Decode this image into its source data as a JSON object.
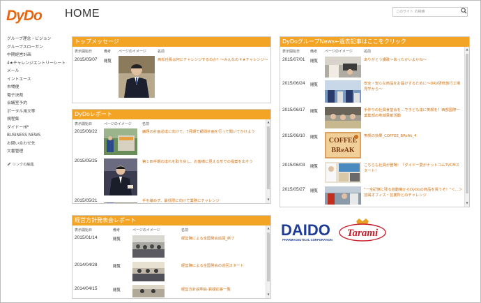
{
  "header": {
    "logo_text": "DyDo",
    "title": "HOME",
    "search_placeholder": "このサイト の検索",
    "colors": {
      "brand": "#e8650d",
      "panel_header": "#f4a425",
      "link": "#d07010"
    }
  },
  "sidebar": {
    "items": [
      {
        "label": "グループ理念・ビジョン"
      },
      {
        "label": "グループスローガン"
      },
      {
        "label": "中期経営計画"
      },
      {
        "label": "4★チャレンジエントリーシート"
      },
      {
        "label": "メール"
      },
      {
        "label": "イントエース"
      },
      {
        "label": "市場便"
      },
      {
        "label": "電子決裁"
      },
      {
        "label": "会議室予約"
      },
      {
        "label": "ポータル用文等"
      },
      {
        "label": "規程集"
      },
      {
        "label": "ダイドーHP"
      },
      {
        "label": "BUSINESS NEWS"
      },
      {
        "label": "お問い合わせ先"
      },
      {
        "label": "文書管理"
      }
    ],
    "edit_link": "リンクの編集"
  },
  "top_message": {
    "title": "トップメッセージ",
    "columns": [
      "表示開始日",
      "備考",
      "ページのイメージ",
      "名前"
    ],
    "rows": [
      {
        "date": "2015/05/07",
        "cat": "閲覧",
        "title": "高松社長は何にチャレンジするのか？～みんなの４★チャレンジ～"
      }
    ]
  },
  "dydo_report": {
    "title": "DyDoレポート",
    "columns": [
      "表示開始日",
      "ページのイメージ",
      "名前"
    ],
    "rows": [
      {
        "date": "2015/06/22",
        "title": "議題の計画必達に向けて、7月期で顧問計画を行って聞いてかけよう"
      },
      {
        "date": "2015/05/25",
        "title": "第１四半期の達れを取り戻し、お客様に見える形での提案を出そう"
      },
      {
        "date": "2015/05/21",
        "title": "手を緩めず、最低限に向けて業務にチャレンジ"
      }
    ]
  },
  "policy_report": {
    "title": "経営方針発表会レポート",
    "columns": [
      "表示開始日",
      "備考",
      "ページのイメージ",
      "名前"
    ],
    "rows": [
      {
        "date": "2015/01/14",
        "cat": "閲覧",
        "title": "経営陣による全国発会巡回_終了"
      },
      {
        "date": "2014/04/28",
        "cat": "閲覧",
        "title": "経営陣による全国発会の巡回スタート"
      },
      {
        "date": "2014/04/15",
        "cat": "閲覧",
        "title": "経営方針説明会-質疑応答一覧"
      }
    ]
  },
  "group_news": {
    "title": "DyDoグループNews←過去記事はここをクリック",
    "columns": [
      "表示開始日",
      "備考",
      "ページのイメージ",
      "名前"
    ],
    "rows": [
      {
        "date": "2015/07/01",
        "cat": "閲覧",
        "title": "ありがとう讃歌～あったかいよかね～"
      },
      {
        "date": "2015/06/24",
        "cat": "閲覧",
        "title": "安全・安心な商品をお届けするために～DRV研修旅行工場見学から～"
      },
      {
        "date": "2015/06/17",
        "cat": "閲覧",
        "title": "手作りの社員食堂会を…で子ども達に笑顔を！西部国際一業集部の地域貢献活動"
      },
      {
        "date": "2015/06/10",
        "cat": "閲覧",
        "title": "笑顔の効果_COFFEE_BReAk_4"
      },
      {
        "date": "2015/06/03",
        "cat": "閲覧",
        "title": "こちらも社員が登場！「ダイドー愛がナットコムTVCMスタート！"
      },
      {
        "date": "2015/05/27",
        "cat": "閲覧",
        "title": "\"一全記憶に残る自動機からDyDoの商品を買うぞ！\"＜…＞芸図オフィス・芸業所とのチャレンジ"
      }
    ]
  },
  "logos": {
    "daido": "DAIDO",
    "daido_sub": "PHARMACEUTICAL CORPORATION",
    "tarami": "Tarami"
  }
}
